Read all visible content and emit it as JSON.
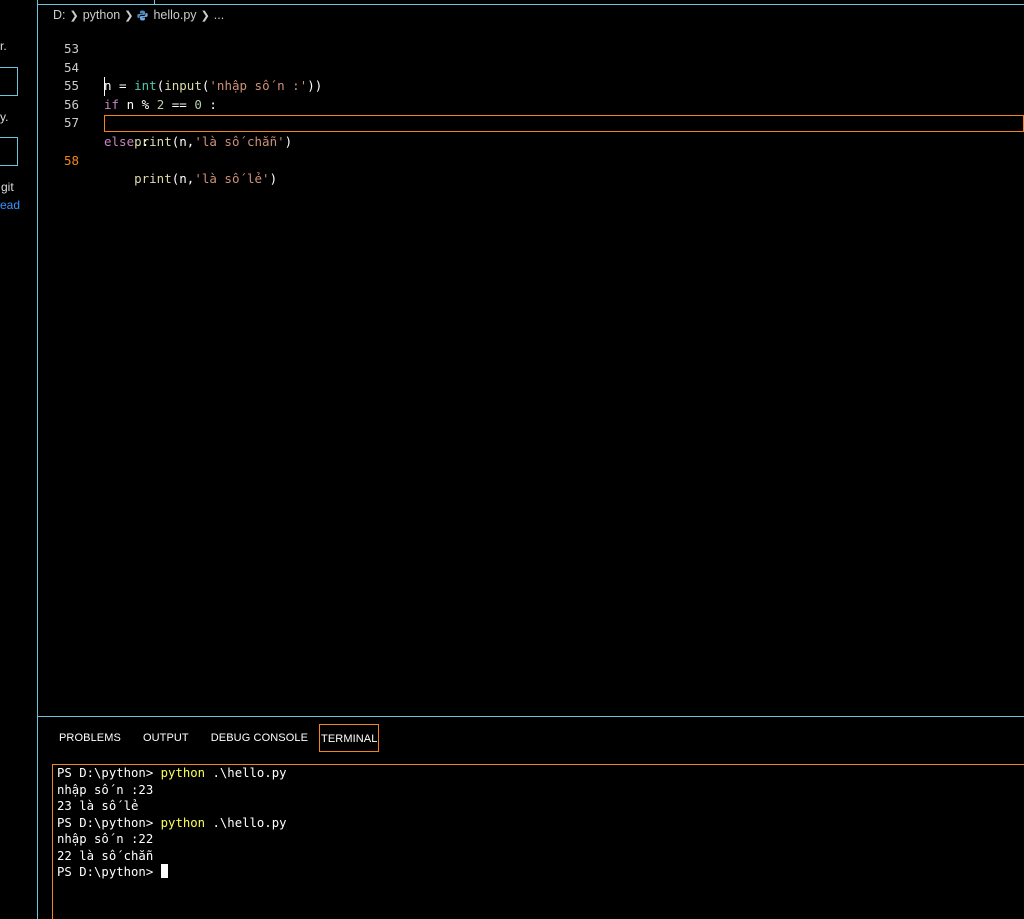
{
  "sidebar": {
    "fragment1": "r.",
    "fragment2": "y.",
    "fragment3": "git",
    "link_fragment": "ead"
  },
  "breadcrumb": {
    "drive": "D:",
    "folder": "python",
    "file": "hello.py",
    "more": "..."
  },
  "editor": {
    "lines": [
      {
        "number": "53",
        "code": ""
      },
      {
        "number": "54",
        "code": "n = int(input('nhập số n :'))"
      },
      {
        "number": "55",
        "code": "if n % 2 == 0 :"
      },
      {
        "number": "56",
        "code": "    print(n,'là số chẵn')"
      },
      {
        "number": "57",
        "code": "else :"
      },
      {
        "number": "58",
        "code": "    print(n,'là số lẻ')"
      }
    ],
    "active_line": "58"
  },
  "panel": {
    "tabs": [
      "PROBLEMS",
      "OUTPUT",
      "DEBUG CONSOLE",
      "TERMINAL"
    ],
    "active_tab": "TERMINAL"
  },
  "terminal": {
    "prompt": "PS D:\\python> ",
    "cmd": "python",
    "arg": " .\\hello.py",
    "out1": "nhập số n :23",
    "out2": "23 là số lẻ",
    "out3": "nhập số n :22",
    "out4": "22 là số chẵn"
  },
  "colors": {
    "focus_border": "#f38518",
    "contrast_border": "#6fc3df"
  }
}
